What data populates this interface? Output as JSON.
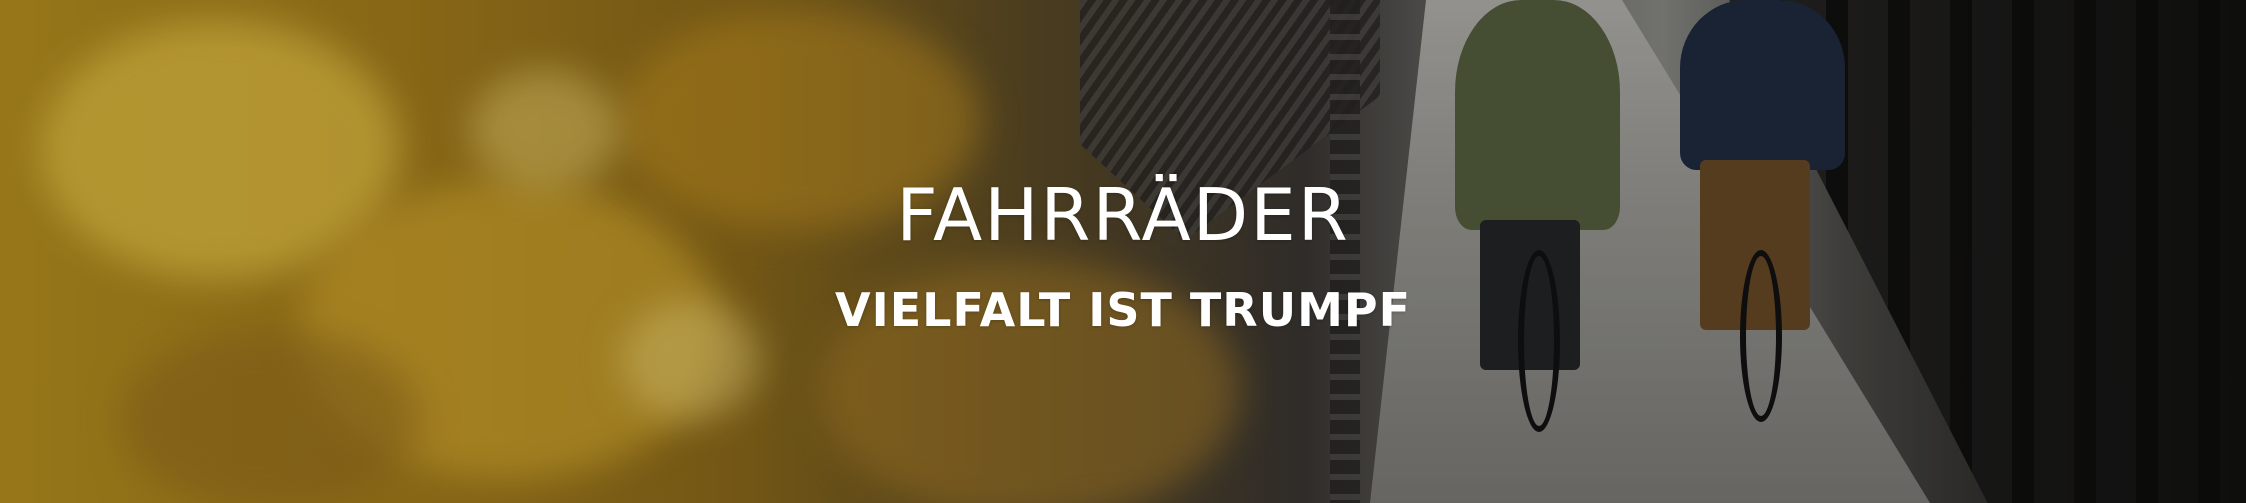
{
  "hero": {
    "title": "FAHRRÄDER",
    "subtitle": "VIELFALT IST TRUMPF"
  },
  "colors": {
    "text": "#ffffff",
    "foliage": "#b8911f",
    "truss": "#121211"
  }
}
